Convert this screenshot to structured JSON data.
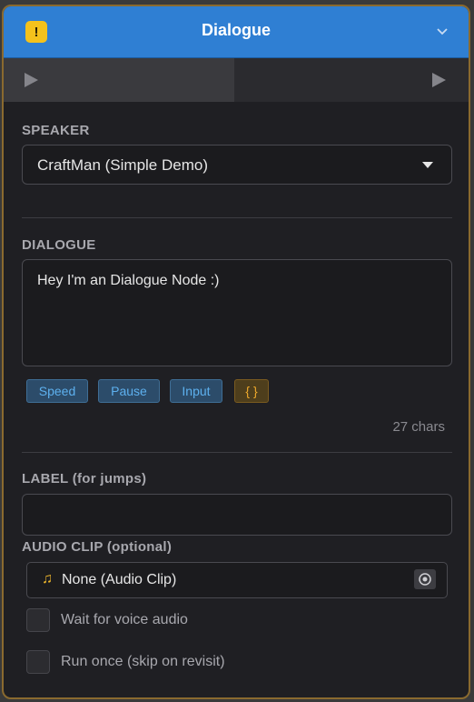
{
  "node": {
    "title": "Dialogue",
    "warning_glyph": "!",
    "icons": {
      "warning": "warning-icon",
      "collapse": "chevron-down-icon",
      "port_in": "play-triangle-icon",
      "port_out": "play-triangle-icon",
      "dropdown": "caret-down-icon",
      "audio": "music-note-icon",
      "picker": "object-picker-icon"
    },
    "colors": {
      "header": "#2f7fd3",
      "warning": "#f4c21c",
      "border": "#8a6a2f",
      "tag_text": "#5db0ee",
      "variable_tag_text": "#f0aa2c"
    }
  },
  "speaker": {
    "label": "SPEAKER",
    "value": "CraftMan (Simple Demo)"
  },
  "dialogue": {
    "label": "DIALOGUE",
    "text": "Hey I'm an Dialogue Node :)",
    "tags": [
      "Speed",
      "Pause",
      "Input",
      "{ }"
    ],
    "char_count": "27 chars"
  },
  "jump_label": {
    "label": "LABEL (for jumps)",
    "value": ""
  },
  "audio_clip": {
    "label": "AUDIO CLIP (optional)",
    "note_glyph": "♫",
    "value": "None (Audio Clip)"
  },
  "options": [
    {
      "label": "Wait for voice audio",
      "checked": false
    },
    {
      "label": "Run once (skip on revisit)",
      "checked": false
    }
  ]
}
